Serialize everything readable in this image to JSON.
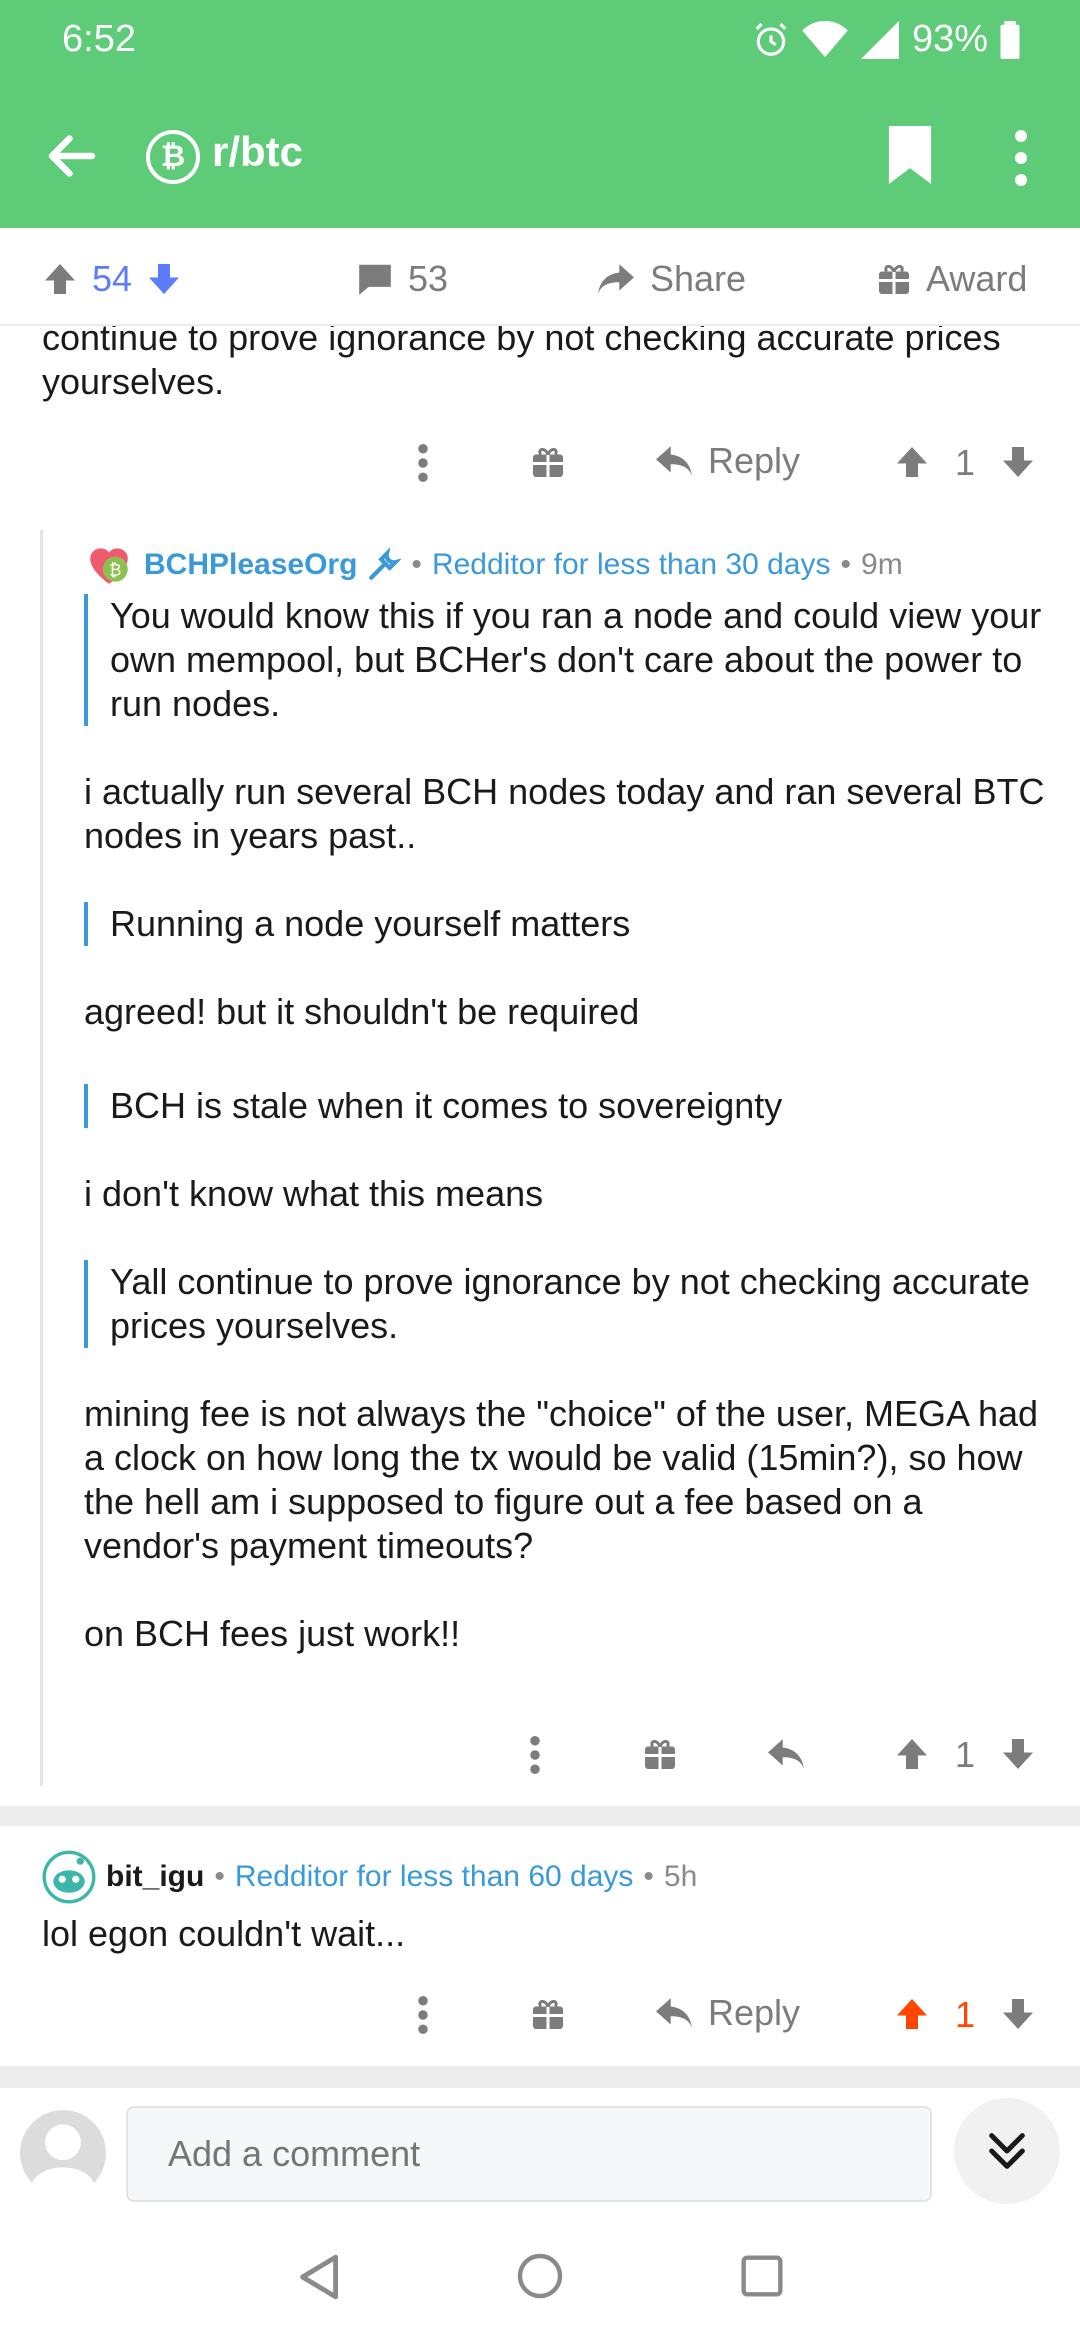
{
  "status": {
    "time": "6:52",
    "battery": "93%"
  },
  "appbar": {
    "subreddit": "r/btc",
    "sub_icon_glyph": "₿"
  },
  "post_bar": {
    "votes": "54",
    "comments": "53",
    "share": "Share",
    "award": "Award"
  },
  "prev_comment": {
    "text_tail": "continue to prove ignorance by not checking accurate prices yourselves.",
    "reply": "Reply",
    "votes": "1"
  },
  "comment1": {
    "author": "BCHPleaseOrg",
    "flair": "Redditor for less than 30 days",
    "time": "9m",
    "quote1": "You would know this if you ran a node and could view your own mempool, but BCHer's don't care about the power to run nodes.",
    "p1": "i actually run several BCH nodes today and ran several BTC nodes in years past..",
    "quote2": "Running a node yourself matters",
    "p2": "agreed! but it shouldn't be required",
    "quote3": "BCH is stale when it comes to sovereignty",
    "p3": "i don't know what this means",
    "quote4": "Yall continue to prove ignorance by not checking accurate prices yourselves.",
    "p4": "mining fee is not always the \"choice\" of the user, MEGA had a clock on how long the tx would be valid (15min?), so how the hell am i supposed to figure out a fee based on a vendor's payment timeouts?",
    "p5": "on BCH fees just work!!",
    "votes": "1"
  },
  "comment2": {
    "author": "bit_igu",
    "flair": "Redditor for less than 60 days",
    "time": "5h",
    "text": "lol egon couldn't wait...",
    "reply": "Reply",
    "votes": "1"
  },
  "compose": {
    "placeholder": "Add a comment"
  },
  "colors": {
    "header": "#5ecb79",
    "link": "#3a9ad9",
    "upvote_active": "#ff4500",
    "vote_count": "#5c7cff"
  }
}
